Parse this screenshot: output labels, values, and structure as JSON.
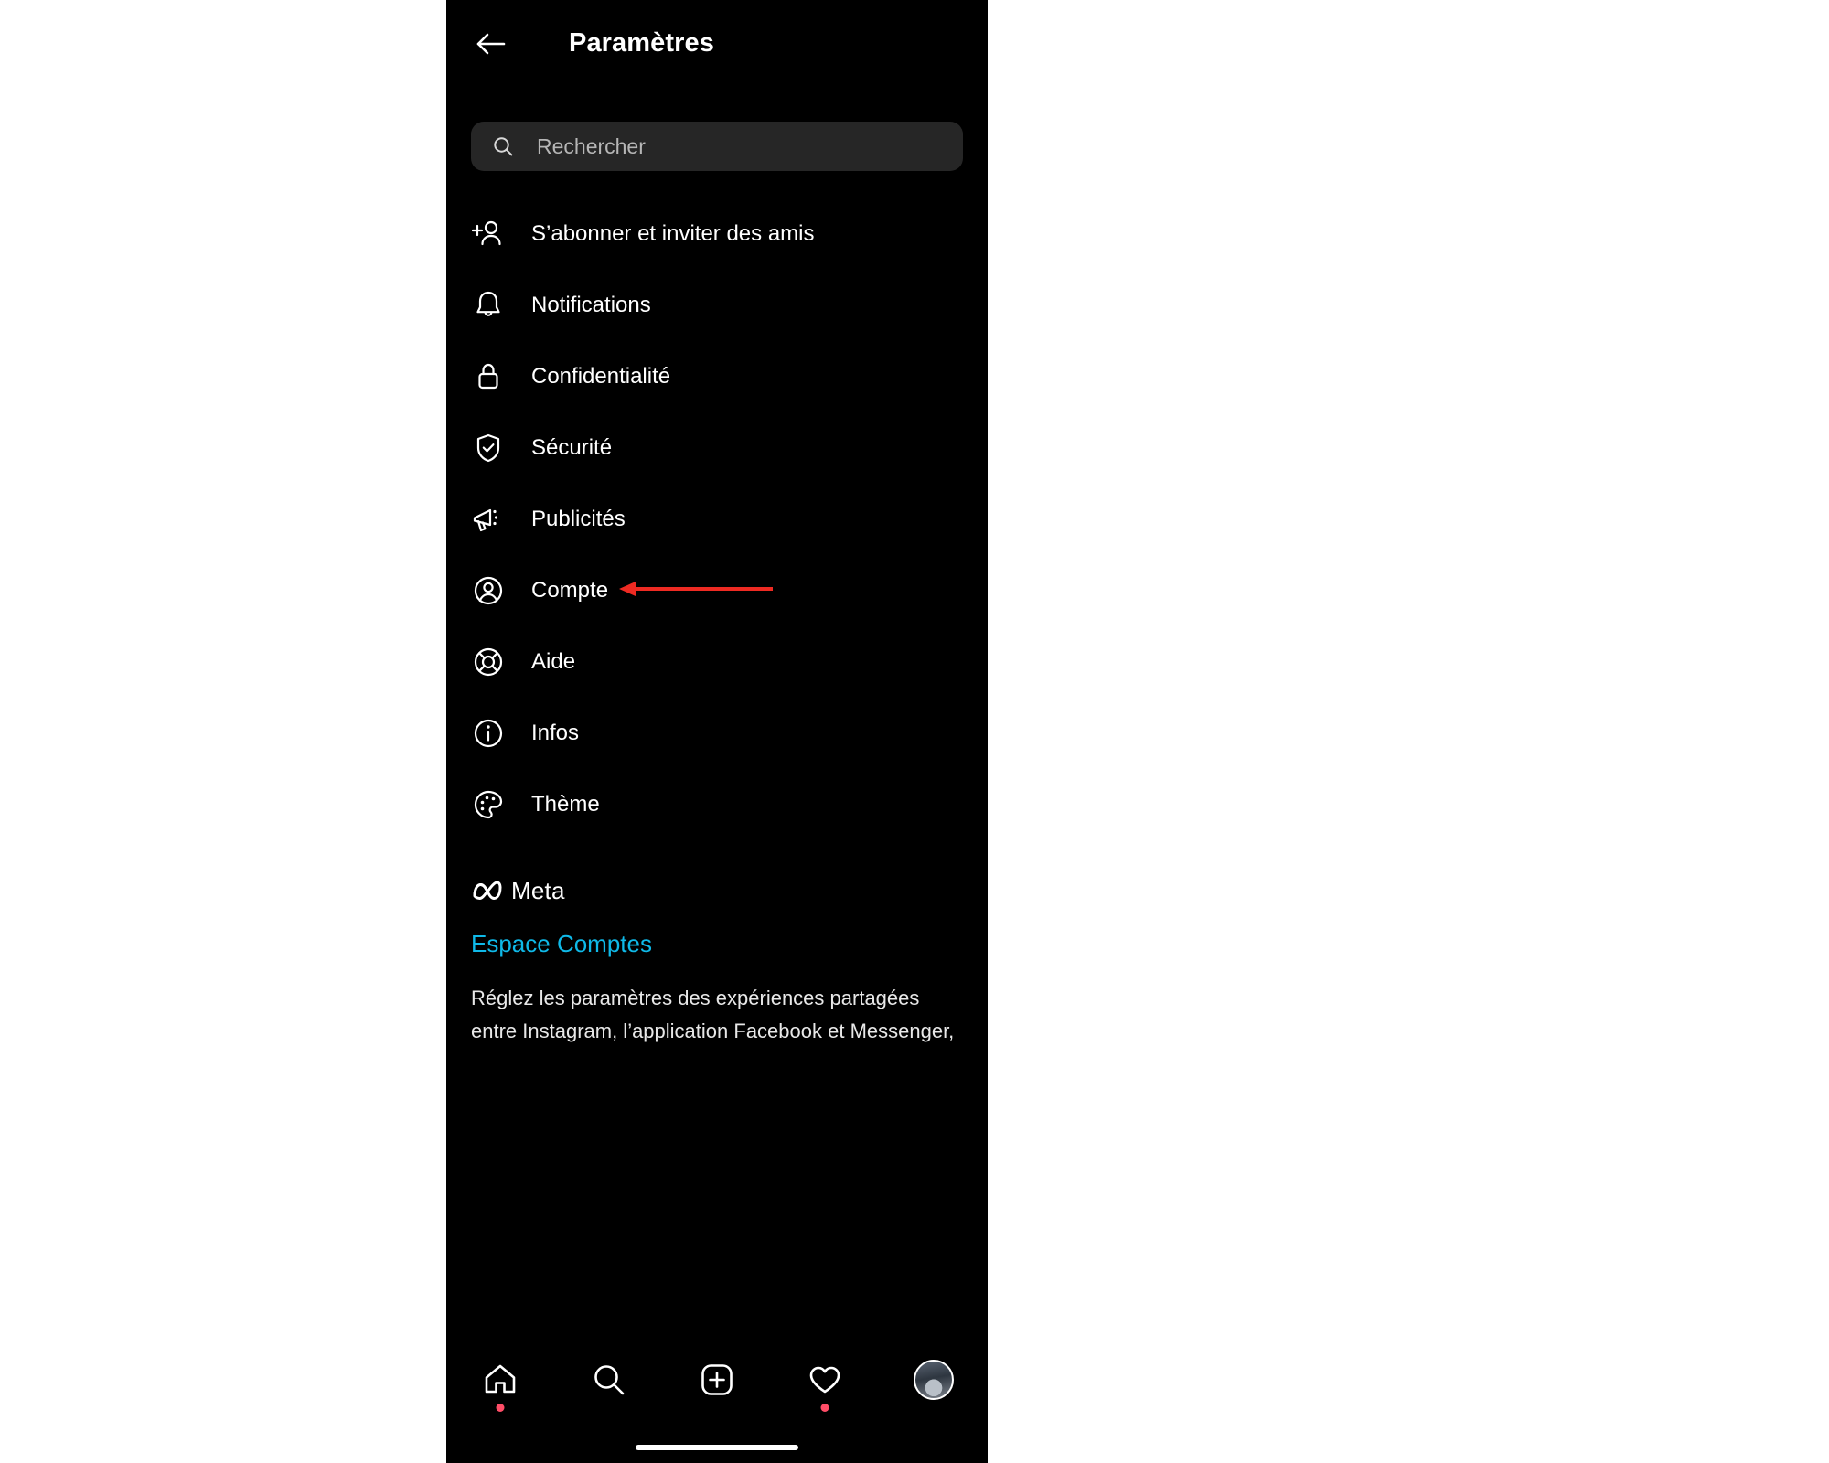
{
  "app": {
    "accent_link_color": "#0fb9e8",
    "background_color": "#000000",
    "annotation_color": "#ee2a22",
    "notification_dot_color": "#ff4d67"
  },
  "header": {
    "back_icon": "arrow-left-icon",
    "title": "Paramètres"
  },
  "search": {
    "icon": "search-icon",
    "placeholder": "Rechercher",
    "value": ""
  },
  "menu": {
    "items": [
      {
        "icon": "person-plus-icon",
        "label": "S’abonner et inviter des amis"
      },
      {
        "icon": "bell-icon",
        "label": "Notifications"
      },
      {
        "icon": "lock-icon",
        "label": "Confidentialité"
      },
      {
        "icon": "shield-check-icon",
        "label": "Sécurité"
      },
      {
        "icon": "megaphone-icon",
        "label": "Publicités"
      },
      {
        "icon": "account-circle-icon",
        "label": "Compte"
      },
      {
        "icon": "life-ring-icon",
        "label": "Aide"
      },
      {
        "icon": "info-circle-icon",
        "label": "Infos"
      },
      {
        "icon": "palette-icon",
        "label": "Thème"
      }
    ]
  },
  "meta_section": {
    "logo_icon": "meta-infinity-icon",
    "brand": "Meta",
    "link": "Espace Comptes",
    "description": "Réglez les paramètres des expériences partagées entre Instagram, l’application Facebook et Messenger, notamment pour le partage de stories et"
  },
  "bottom_nav": {
    "items": [
      {
        "icon": "home-icon",
        "label": "Accueil",
        "badge": true
      },
      {
        "icon": "search-icon",
        "label": "Recherche",
        "badge": false
      },
      {
        "icon": "plus-square-icon",
        "label": "Créer",
        "badge": false
      },
      {
        "icon": "heart-icon",
        "label": "Notifications",
        "badge": true
      },
      {
        "icon": "profile-avatar",
        "label": "Profil",
        "badge": false
      }
    ]
  },
  "annotation": {
    "type": "arrow-left",
    "target": "Compte"
  }
}
